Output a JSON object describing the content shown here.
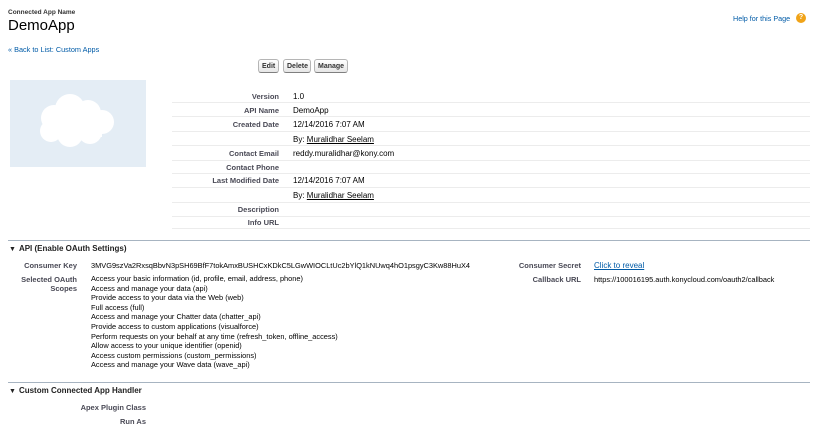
{
  "header": {
    "subtitle": "Connected App Name",
    "title": "DemoApp",
    "help_link": "Help for this Page",
    "help_icon": "?"
  },
  "breadcrumb": {
    "back_link": "« Back to List: Custom Apps"
  },
  "toolbar": {
    "edit": "Edit",
    "delete": "Delete",
    "manage": "Manage"
  },
  "details": {
    "version_label": "Version",
    "version": "1.0",
    "api_name_label": "API Name",
    "api_name": "DemoApp",
    "created_date_label": "Created Date",
    "created_date": "12/14/2016 7:07 AM",
    "created_by_prefix": "By:",
    "created_by": "Muralidhar Seelam",
    "contact_email_label": "Contact Email",
    "contact_email": "reddy.muralidhar@kony.com",
    "contact_phone_label": "Contact Phone",
    "last_modified_label": "Last Modified Date",
    "last_modified": "12/14/2016 7:07 AM",
    "modified_by_prefix": "By:",
    "modified_by": "Muralidhar Seelam",
    "description_label": "Description",
    "info_url_label": "Info URL"
  },
  "api_section": {
    "title": "API (Enable OAuth Settings)",
    "consumer_key_label": "Consumer Key",
    "consumer_key": "3MVG9szVa2RxsqBbvN3pSH69BfF7tokAmxBUSHCxKDkC5LGwWIOCLtUc2bYlQ1kNUwq4hO1psgyC3Kw88HuX4",
    "consumer_secret_label": "Consumer Secret",
    "consumer_secret_link": "Click to reveal",
    "scopes_label_1": "Selected OAuth",
    "scopes_label_2": "Scopes",
    "callback_label": "Callback URL",
    "callback_url": "https://100016195.auth.konycloud.com/oauth2/callback",
    "scopes": [
      "Access your basic information (id, profile, email, address, phone)",
      "Access and manage your data (api)",
      "Provide access to your data via the Web (web)",
      "Full access (full)",
      "Access and manage your Chatter data (chatter_api)",
      "Provide access to custom applications (visualforce)",
      "Perform requests on your behalf at any time (refresh_token, offline_access)",
      "Allow access to your unique identifier (openid)",
      "Access custom permissions (custom_permissions)",
      "Access and manage your Wave data (wave_api)"
    ]
  },
  "handler_section": {
    "title": "Custom Connected App Handler",
    "apex_label": "Apex Plugin Class",
    "run_as_label": "Run As"
  },
  "colors": {
    "link": "#015ba7",
    "section_rule": "#a7b4c1",
    "logo_bg": "#e4edf5"
  }
}
